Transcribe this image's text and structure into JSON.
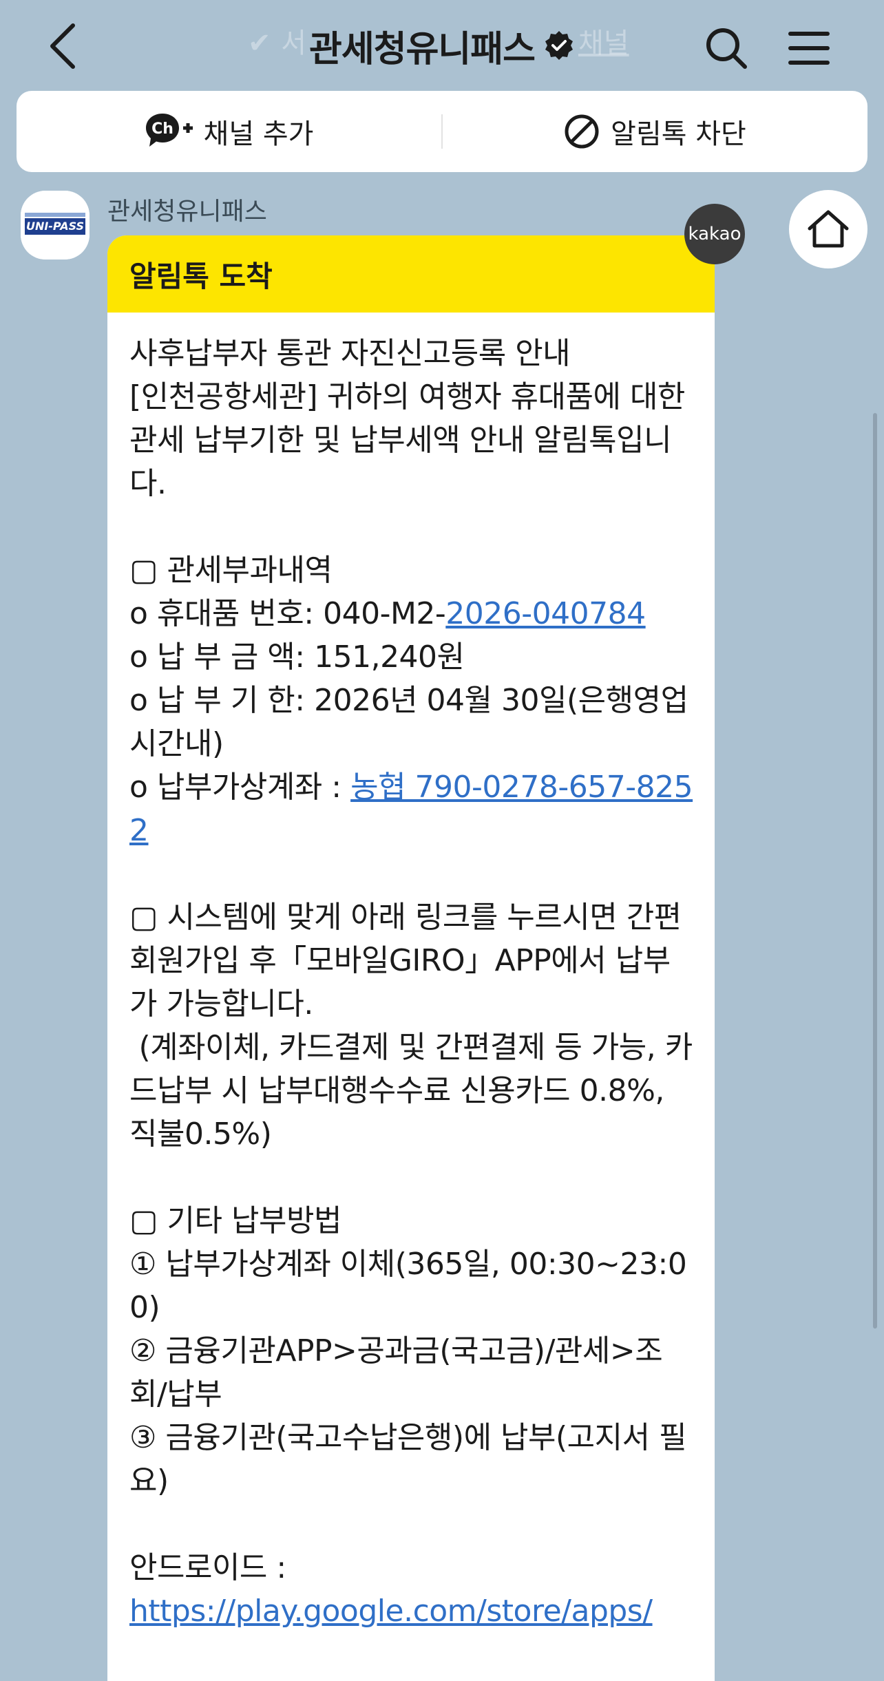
{
  "header": {
    "title": "관세청유니패스",
    "ghost_left": "✔ 서",
    "ghost_right": "채널"
  },
  "action_bar": {
    "add_channel_label": "채널 추가",
    "block_label": "알림톡 차단"
  },
  "message": {
    "sender": "관세청유니패스",
    "profile_logo_text": "UNI-PASS",
    "badge": "kakao",
    "header": "알림톡 도착",
    "intro_title": "사후납부자 통관 자진신고등록 안내",
    "intro_body": "[인천공항세관] 귀하의 여행자 휴대품에 대한 관세 납부기한 및 납부세액 안내 알림톡입니다.",
    "section1_title": "▢ 관세부과내역",
    "item_no_label": "o 휴대품 번호: 040-M2-",
    "item_no_link": "2026-040784",
    "amount": "o 납 부 금 액: 151,240원",
    "due": "o 납 부 기 한: 2026년 04월 30일(은행영업시간내)",
    "account_label": "o 납부가상계좌 : ",
    "account_link": "농협 790-0278-657-8252",
    "section2_title": "▢ 시스템에 맞게 아래 링크를 누르시면 간편 회원가입 후「모바일GIRO」APP에서 납부가 가능합니다.",
    "section2_note": " (계좌이체, 카드결제 및 간편결제 등 가능, 카드납부 시 납부대행수수료 신용카드 0.8%, 직불0.5%)",
    "section3_title": "▢ 기타 납부방법",
    "method1": "① 납부가상계좌 이체(365일, 00:30~23:00)",
    "method2": "② 금융기관APP>공과금(국고금)/관세>조회/납부",
    "method3": "③ 금융기관(국고수납은행)에 납부(고지서 필요)",
    "android_label": "안드로이드 :",
    "android_link": "https://play.google.com/store/apps/"
  },
  "colors": {
    "background": "#abc1d1",
    "bubble_header": "#fde500",
    "link": "#2f6fc7"
  }
}
